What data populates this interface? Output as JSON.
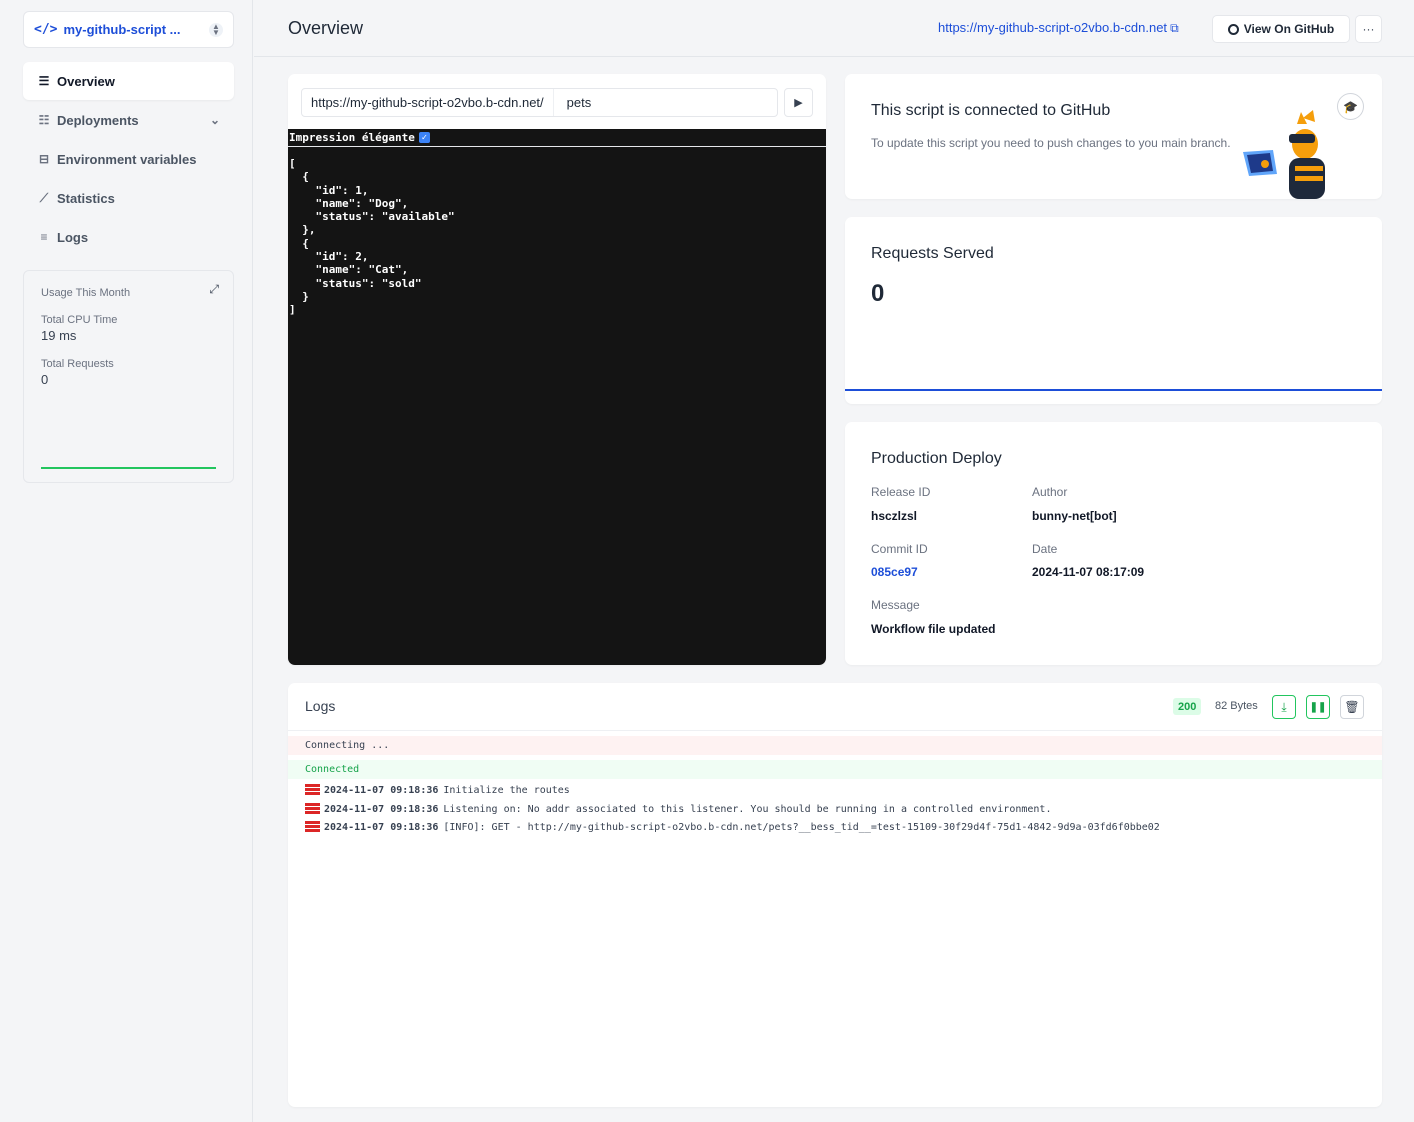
{
  "sidebar": {
    "script_name": "my-github-script ...",
    "code_icon": "</>",
    "nav": [
      {
        "label": "Overview",
        "icon": "list-icon"
      },
      {
        "label": "Deployments",
        "icon": "server-icon"
      },
      {
        "label": "Environment variables",
        "icon": "env-icon"
      },
      {
        "label": "Statistics",
        "icon": "chart-icon"
      },
      {
        "label": "Logs",
        "icon": "logs-icon"
      }
    ],
    "usage": {
      "title": "Usage This Month",
      "cpu_label": "Total CPU Time",
      "cpu_value": "19 ms",
      "requests_label": "Total Requests",
      "requests_value": "0"
    }
  },
  "header": {
    "title": "Overview",
    "url": "https://my-github-script-o2vbo.b-cdn.net",
    "view_github": "View On GitHub",
    "more": "···"
  },
  "tester": {
    "url_prefix": "https://my-github-script-o2vbo.b-cdn.net/",
    "path": "pets",
    "pretty_label": "Impression élégante",
    "json_output": "[\n  {\n    \"id\": 1,\n    \"name\": \"Dog\",\n    \"status\": \"available\"\n  },\n  {\n    \"id\": 2,\n    \"name\": \"Cat\",\n    \"status\": \"sold\"\n  }\n]"
  },
  "github_card": {
    "title": "This script is connected to GitHub",
    "description": "To update this script you need to push changes to you main branch."
  },
  "requests": {
    "title": "Requests Served",
    "value": "0"
  },
  "deploy": {
    "title": "Production Deploy",
    "release_id_label": "Release ID",
    "release_id": "hsczlzsl",
    "author_label": "Author",
    "author": "bunny-net[bot]",
    "commit_label": "Commit ID",
    "commit": "085ce97",
    "date_label": "Date",
    "date": "2024-11-07 08:17:09",
    "message_label": "Message",
    "message": "Workflow file updated"
  },
  "logs": {
    "title": "Logs",
    "status": "200",
    "bytes": "82 Bytes",
    "connecting": "Connecting ...",
    "connected": "Connected",
    "lines": [
      {
        "time": "2024-11-07 09:18:36",
        "text": "Initialize the routes"
      },
      {
        "time": "2024-11-07 09:18:36",
        "text": "Listening on: No addr associated to this listener. You should be running in a controlled environment."
      },
      {
        "time": "2024-11-07 09:18:36",
        "text": "[INFO]: GET - http://my-github-script-o2vbo.b-cdn.net/pets?__bess_tid__=test-15109-30f29d4f-75d1-4842-9d9a-03fd6f0bbe02"
      }
    ]
  },
  "colors": {
    "accent": "#1d4ed8",
    "success": "#22c55e",
    "console_bg": "#141414"
  }
}
